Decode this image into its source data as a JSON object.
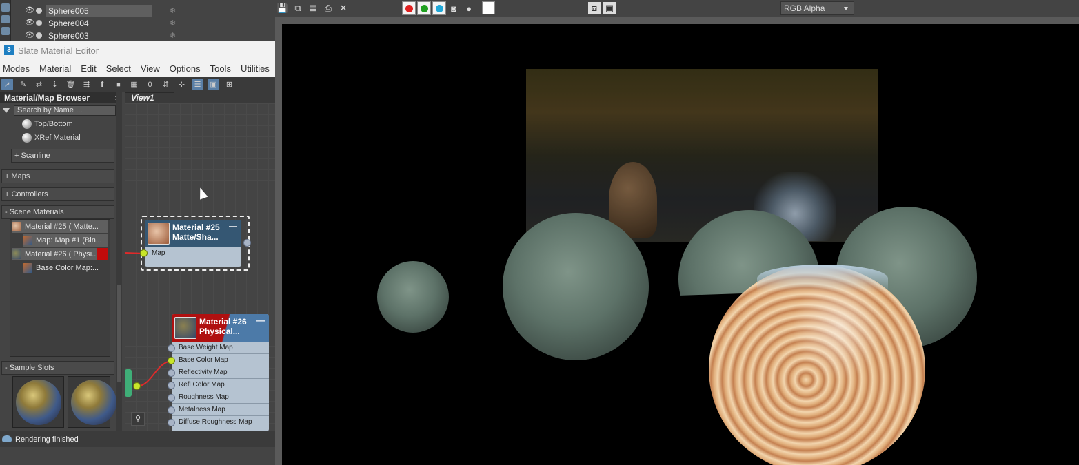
{
  "explorer": {
    "objects": [
      {
        "name": "Sphere005",
        "selected": true
      },
      {
        "name": "Sphere004",
        "selected": false
      },
      {
        "name": "Sphere003",
        "selected": false
      }
    ]
  },
  "slate": {
    "title": "Slate Material Editor",
    "menu": [
      "Modes",
      "Material",
      "Edit",
      "Select",
      "View",
      "Options",
      "Tools",
      "Utilities"
    ],
    "browser": {
      "title": "Material/Map Browser",
      "close": "×",
      "search_placeholder": "Search by Name ...",
      "items": [
        "Top/Bottom",
        "XRef Material"
      ],
      "rollouts": {
        "scanline": "+ Scanline",
        "maps": "+ Maps",
        "controllers": "+ Controllers",
        "scene_materials": "- Scene Materials",
        "sample_slots": "- Sample Slots"
      },
      "scene_materials": [
        "Material #25  ( Matte...",
        "Map: Map #1 (Bin...",
        "Material #26  ( Physi...",
        "Base Color Map:..."
      ]
    },
    "view_tab": "View1",
    "node25": {
      "title_line1": "Material #25",
      "title_line2": "Matte/Sha...",
      "min": "—",
      "slots": [
        "Map"
      ]
    },
    "node26": {
      "title_line1": "Material #26",
      "title_line2": "Physical...",
      "min": "—",
      "slots": [
        "Base Weight Map",
        "Base Color Map",
        "Reflectivity Map",
        "Refl Color Map",
        "Roughness Map",
        "Metalness Map",
        "Diffuse Roughness Map"
      ]
    },
    "status": "Rendering finished"
  },
  "render": {
    "channel": "RGB Alpha",
    "colors": {
      "red": "#e02020",
      "green": "#20a020",
      "blue": "#20a8d8"
    }
  }
}
